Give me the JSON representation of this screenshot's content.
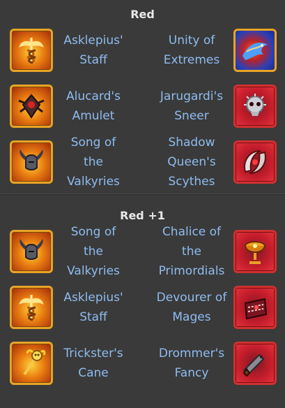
{
  "sections": [
    {
      "title": "Red",
      "rows": [
        {
          "left": {
            "name": "Asklepius' Staff",
            "icon": "caduceus-icon"
          },
          "right": {
            "name": "Unity of Extremes",
            "icon": "dragon-icon"
          }
        },
        {
          "left": {
            "name": "Alucard's Amulet",
            "icon": "amulet-icon"
          },
          "right": {
            "name": "Jarugardi's Sneer",
            "icon": "skull-icon"
          }
        },
        {
          "left": {
            "name": "Song of the Valkyries",
            "icon": "winged-helmet-icon"
          },
          "right": {
            "name": "Shadow Queen's Scythes",
            "icon": "scythes-icon"
          }
        }
      ]
    },
    {
      "title": "Red +1",
      "rows": [
        {
          "left": {
            "name": "Song of the Valkyries",
            "icon": "winged-helmet-icon"
          },
          "right": {
            "name": "Chalice of the Primordials",
            "icon": "chalice-icon"
          }
        },
        {
          "left": {
            "name": "Asklepius' Staff",
            "icon": "caduceus-icon"
          },
          "right": {
            "name": "Devourer of Mages",
            "icon": "devourer-chest-icon"
          }
        },
        {
          "left": {
            "name": "Trickster's Cane",
            "icon": "jester-cane-icon"
          },
          "right": {
            "name": "Drommer's Fancy",
            "icon": "pistol-icon"
          }
        }
      ]
    }
  ],
  "colors": {
    "background": "#3a3a3a",
    "title": "#e9e9e9",
    "item_name": "#8fbcf0",
    "gold_frame": "#e8a425",
    "red_frame": "#d23030"
  }
}
